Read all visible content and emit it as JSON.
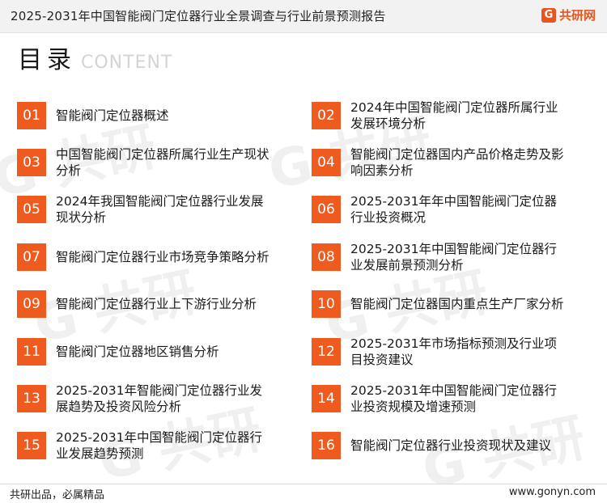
{
  "header": {
    "title": "2025-2031年中国智能阀门定位器行业全景调查与行业前景预测报告",
    "logo_text": "共研网",
    "logo_mark": "G",
    "logo_icon": "gonyn-logo-icon"
  },
  "heading": {
    "main": "目录",
    "sub": "CONTENT"
  },
  "toc": [
    {
      "num": "01",
      "label": "智能阀门定位器概述"
    },
    {
      "num": "02",
      "label": "2024年中国智能阀门定位器所属行业发展环境分析"
    },
    {
      "num": "03",
      "label": "中国智能阀门定位器所属行业生产现状分析"
    },
    {
      "num": "04",
      "label": "智能阀门定位器国内产品价格走势及影响因素分析"
    },
    {
      "num": "05",
      "label": "2024年我国智能阀门定位器行业发展现状分析"
    },
    {
      "num": "06",
      "label": "2025-2031年年中国智能阀门定位器行业投资概况"
    },
    {
      "num": "07",
      "label": "智能阀门定位器行业市场竞争策略分析"
    },
    {
      "num": "08",
      "label": "2025-2031年中国智能阀门定位器行业发展前景预测分析"
    },
    {
      "num": "09",
      "label": "智能阀门定位器行业上下游行业分析"
    },
    {
      "num": "10",
      "label": "智能阀门定位器国内重点生产厂家分析"
    },
    {
      "num": "11",
      "label": "智能阀门定位器地区销售分析"
    },
    {
      "num": "12",
      "label": "2025-2031年市场指标预测及行业项目投资建议"
    },
    {
      "num": "13",
      "label": "2025-2031年智能阀门定位器行业发展趋势及投资风险分析"
    },
    {
      "num": "14",
      "label": "2025-2031年中国智能阀门定位器行业投资规模及增速预测"
    },
    {
      "num": "15",
      "label": "2025-2031年中国智能阀门定位器行业发展趋势预测"
    },
    {
      "num": "16",
      "label": "智能阀门定位器行业投资现状及建议"
    }
  ],
  "footer": {
    "slogan": "共研出品，必属精品",
    "url": "www.gonyn.com"
  },
  "colors": {
    "accent": "#ef5a1f",
    "logo": "#e8551f",
    "header_bg": "#f2f2f2"
  }
}
